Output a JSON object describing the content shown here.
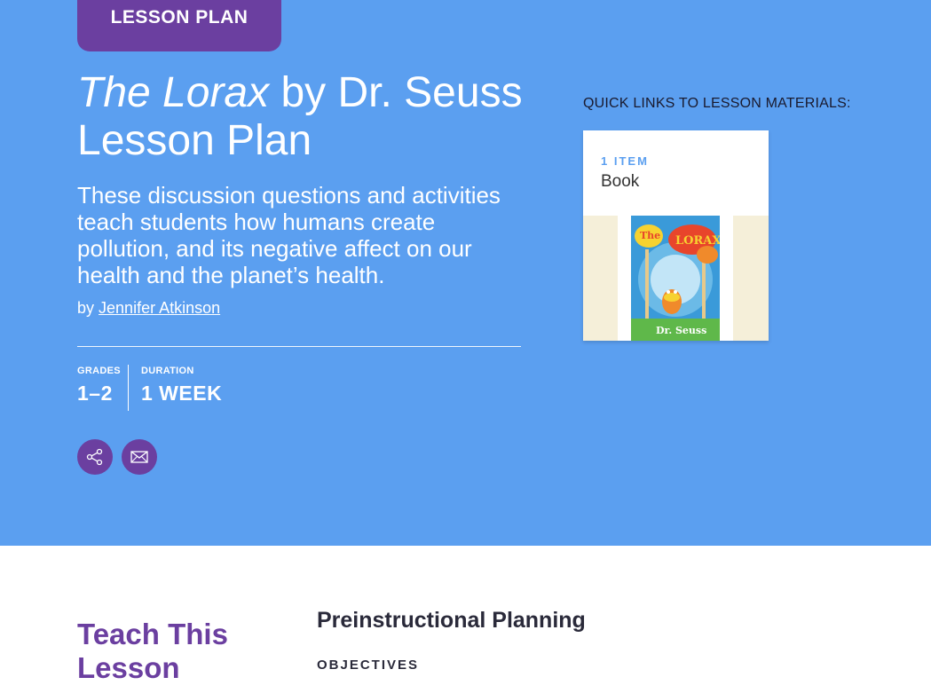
{
  "hero": {
    "tag": "LESSON PLAN",
    "title_italic": "The Lorax",
    "title_rest": " by Dr. Seuss Lesson Plan",
    "description": "These discussion questions and activities teach students how humans create pollution, and its negative affect on our health and the planet’s health.",
    "by_prefix": "by",
    "author": "Jennifer  Atkinson",
    "grades_label": "GRADES",
    "grades_value": "1–2",
    "duration_label": "DURATION",
    "duration_value": "1 WEEK",
    "share_icon": "share-icon",
    "email_icon": "email-icon"
  },
  "quick_links": {
    "heading": "QUICK LINKS TO LESSON MATERIALS:",
    "card": {
      "count": "1 ITEM",
      "type": "Book",
      "book_title": "The LORAX",
      "book_author": "Dr. Seuss"
    }
  },
  "lesson": {
    "teach_heading": "Teach This Lesson",
    "section_title": "Preinstructional Planning",
    "objectives_label": "OBJECTIVES"
  },
  "colors": {
    "hero_bg": "#5b9ff0",
    "accent_purple": "#6b3fa0",
    "card_bg": "#ffffff",
    "card_img_bg": "#f5efd9"
  }
}
